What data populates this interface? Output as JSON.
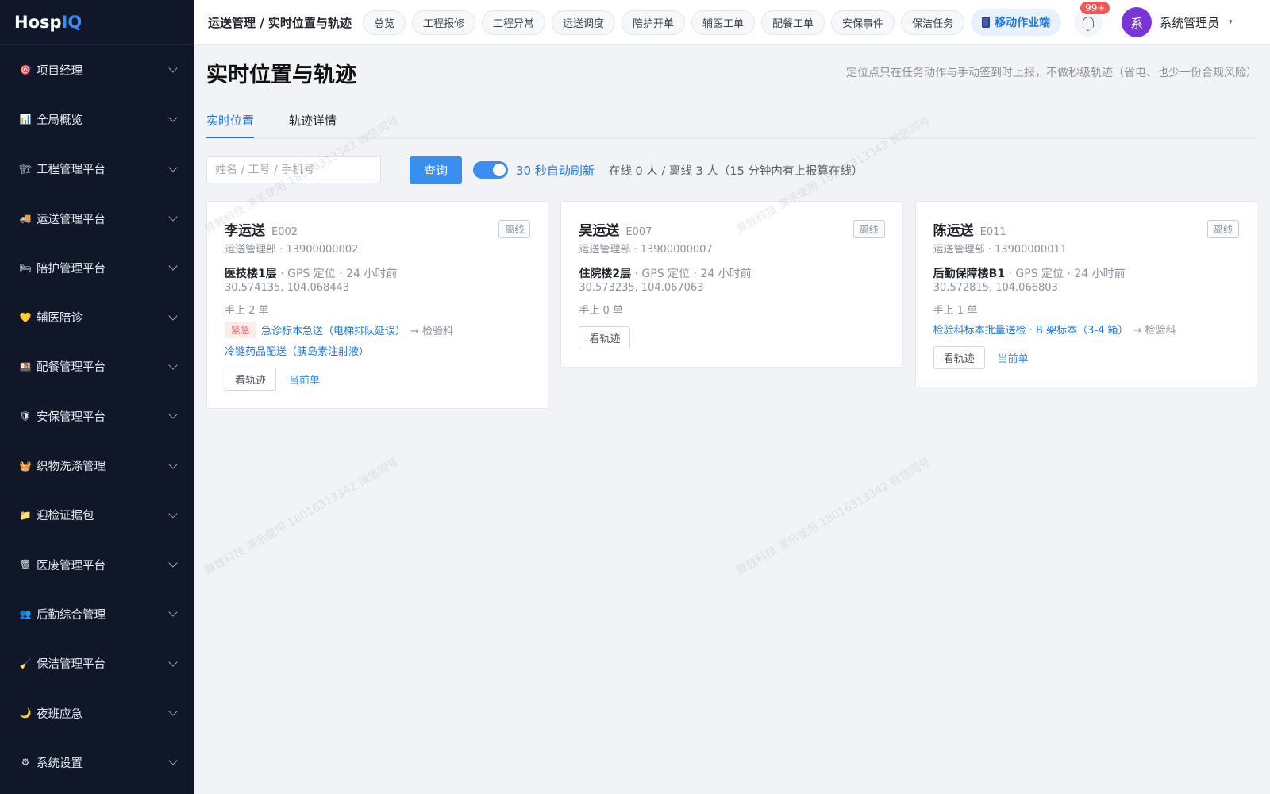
{
  "app": {
    "logo_main": "Hosp",
    "logo_accent": "IQ"
  },
  "sidebar": {
    "items": [
      {
        "label": "项目经理",
        "icon": "target-icon",
        "glyph": "🎯"
      },
      {
        "label": "全局概览",
        "icon": "chart-icon",
        "glyph": "📊"
      },
      {
        "label": "工程管理平台",
        "icon": "building-icon",
        "glyph": "🏗"
      },
      {
        "label": "运送管理平台",
        "icon": "truck-icon",
        "glyph": "🚚"
      },
      {
        "label": "陪护管理平台",
        "icon": "bed-icon",
        "glyph": "🛏"
      },
      {
        "label": "辅医陪诊",
        "icon": "heart-icon",
        "glyph": "💛"
      },
      {
        "label": "配餐管理平台",
        "icon": "meal-icon",
        "glyph": "🍱"
      },
      {
        "label": "安保管理平台",
        "icon": "shield-icon",
        "glyph": "🛡"
      },
      {
        "label": "织物洗涤管理",
        "icon": "basket-icon",
        "glyph": "🧺"
      },
      {
        "label": "迎检证据包",
        "icon": "folder-icon",
        "glyph": "📁"
      },
      {
        "label": "医废管理平台",
        "icon": "trash-icon",
        "glyph": "🗑"
      },
      {
        "label": "后勤综合管理",
        "icon": "people-icon",
        "glyph": "👥"
      },
      {
        "label": "保洁管理平台",
        "icon": "broom-icon",
        "glyph": "🧹"
      },
      {
        "label": "夜班应急",
        "icon": "moon-icon",
        "glyph": "🌙"
      },
      {
        "label": "系统设置",
        "icon": "gear-icon",
        "glyph": "⚙"
      }
    ]
  },
  "topbar": {
    "breadcrumb": "运送管理 / 实时位置与轨迹",
    "tabs": [
      "总览",
      "工程报修",
      "工程异常",
      "运送调度",
      "陪护开单",
      "辅医工单",
      "配餐工单",
      "安保事件",
      "保洁任务"
    ],
    "mobile_label": "移动作业端",
    "badge": "99+",
    "avatar_text": "系",
    "username": "系统管理员"
  },
  "page": {
    "title": "实时位置与轨迹",
    "hint": "定位点只在任务动作与手动签到时上报，不做秒级轨迹（省电、也少一份合规风险）",
    "tabs": [
      "实时位置",
      "轨迹详情"
    ],
    "search_placeholder": "姓名 / 工号 / 手机号",
    "query_label": "查询",
    "refresh_label": "30 秒自动刷新",
    "online_stat": "在线 0 人 / 离线 3 人（15 分钟内有上报算在线）"
  },
  "cards": [
    {
      "name": "李运送",
      "id": "E002",
      "status": "离线",
      "dept": "运送管理部 · 13900000002",
      "building": "医技楼1层",
      "loc_meta": " · GPS 定位 · 24 小时前",
      "coord": "30.574135, 104.068443",
      "count": "手上 2 单",
      "orders": [
        {
          "urgent": "紧急",
          "title": "急诊标本急送（电梯排队延误）",
          "dest": "→ 检验科"
        },
        {
          "urgent": "",
          "title": "冷链药品配送（胰岛素注射液）",
          "dest": ""
        }
      ],
      "track_label": "看轨迹",
      "current_label": "当前单"
    },
    {
      "name": "吴运送",
      "id": "E007",
      "status": "离线",
      "dept": "运送管理部 · 13900000007",
      "building": "住院楼2层",
      "loc_meta": " · GPS 定位 · 24 小时前",
      "coord": "30.573235, 104.067063",
      "count": "手上 0 单",
      "orders": [],
      "track_label": "看轨迹",
      "current_label": ""
    },
    {
      "name": "陈运送",
      "id": "E011",
      "status": "离线",
      "dept": "运送管理部 · 13900000011",
      "building": "后勤保障楼B1",
      "loc_meta": " · GPS 定位 · 24 小时前",
      "coord": "30.572815, 104.066803",
      "count": "手上 1 单",
      "orders": [
        {
          "urgent": "",
          "title": "检验科标本批量送检 · B 架标本（3-4 箱）",
          "dest": "→ 检验科"
        }
      ],
      "track_label": "看轨迹",
      "current_label": "当前单"
    }
  ],
  "watermark": "算数科技 演示使用 18016313342 微信同号"
}
